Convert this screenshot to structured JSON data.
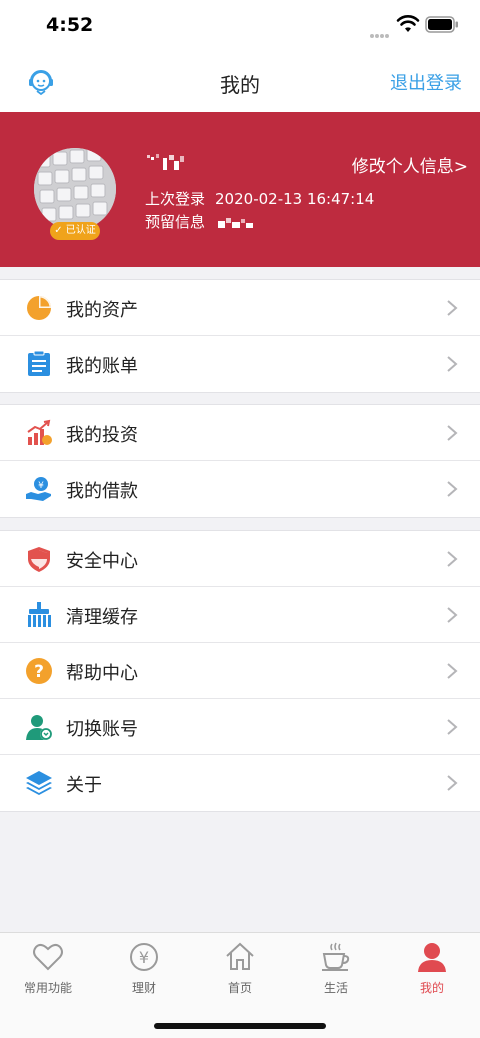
{
  "status": {
    "time": "4:52"
  },
  "nav": {
    "title": "我的",
    "logout": "退出登录"
  },
  "profile": {
    "edit_label": "修改个人信息>",
    "last_login_label": "上次登录",
    "last_login_value": "2020-02-13 16:47:14",
    "reserved_label": "预留信息",
    "verified_badge": "已认证"
  },
  "menu_groups": [
    [
      {
        "label": "我的资产",
        "icon": "pie-chart-icon"
      },
      {
        "label": "我的账单",
        "icon": "clipboard-icon"
      }
    ],
    [
      {
        "label": "我的投资",
        "icon": "investment-chart-icon"
      },
      {
        "label": "我的借款",
        "icon": "loan-hand-icon"
      }
    ],
    [
      {
        "label": "安全中心",
        "icon": "shield-icon"
      },
      {
        "label": "清理缓存",
        "icon": "broom-icon"
      },
      {
        "label": "帮助中心",
        "icon": "help-icon"
      },
      {
        "label": "切换账号",
        "icon": "switch-user-icon"
      },
      {
        "label": "关于",
        "icon": "layers-icon"
      }
    ]
  ],
  "tabs": [
    {
      "label": "常用功能",
      "icon": "heart-icon"
    },
    {
      "label": "理财",
      "icon": "yen-icon"
    },
    {
      "label": "首页",
      "icon": "home-icon"
    },
    {
      "label": "生活",
      "icon": "coffee-icon"
    },
    {
      "label": "我的",
      "icon": "user-icon",
      "active": true
    }
  ],
  "colors": {
    "brand_red": "#be2b3f",
    "accent_blue": "#3aa0e6",
    "active_tab": "#e04a50"
  }
}
